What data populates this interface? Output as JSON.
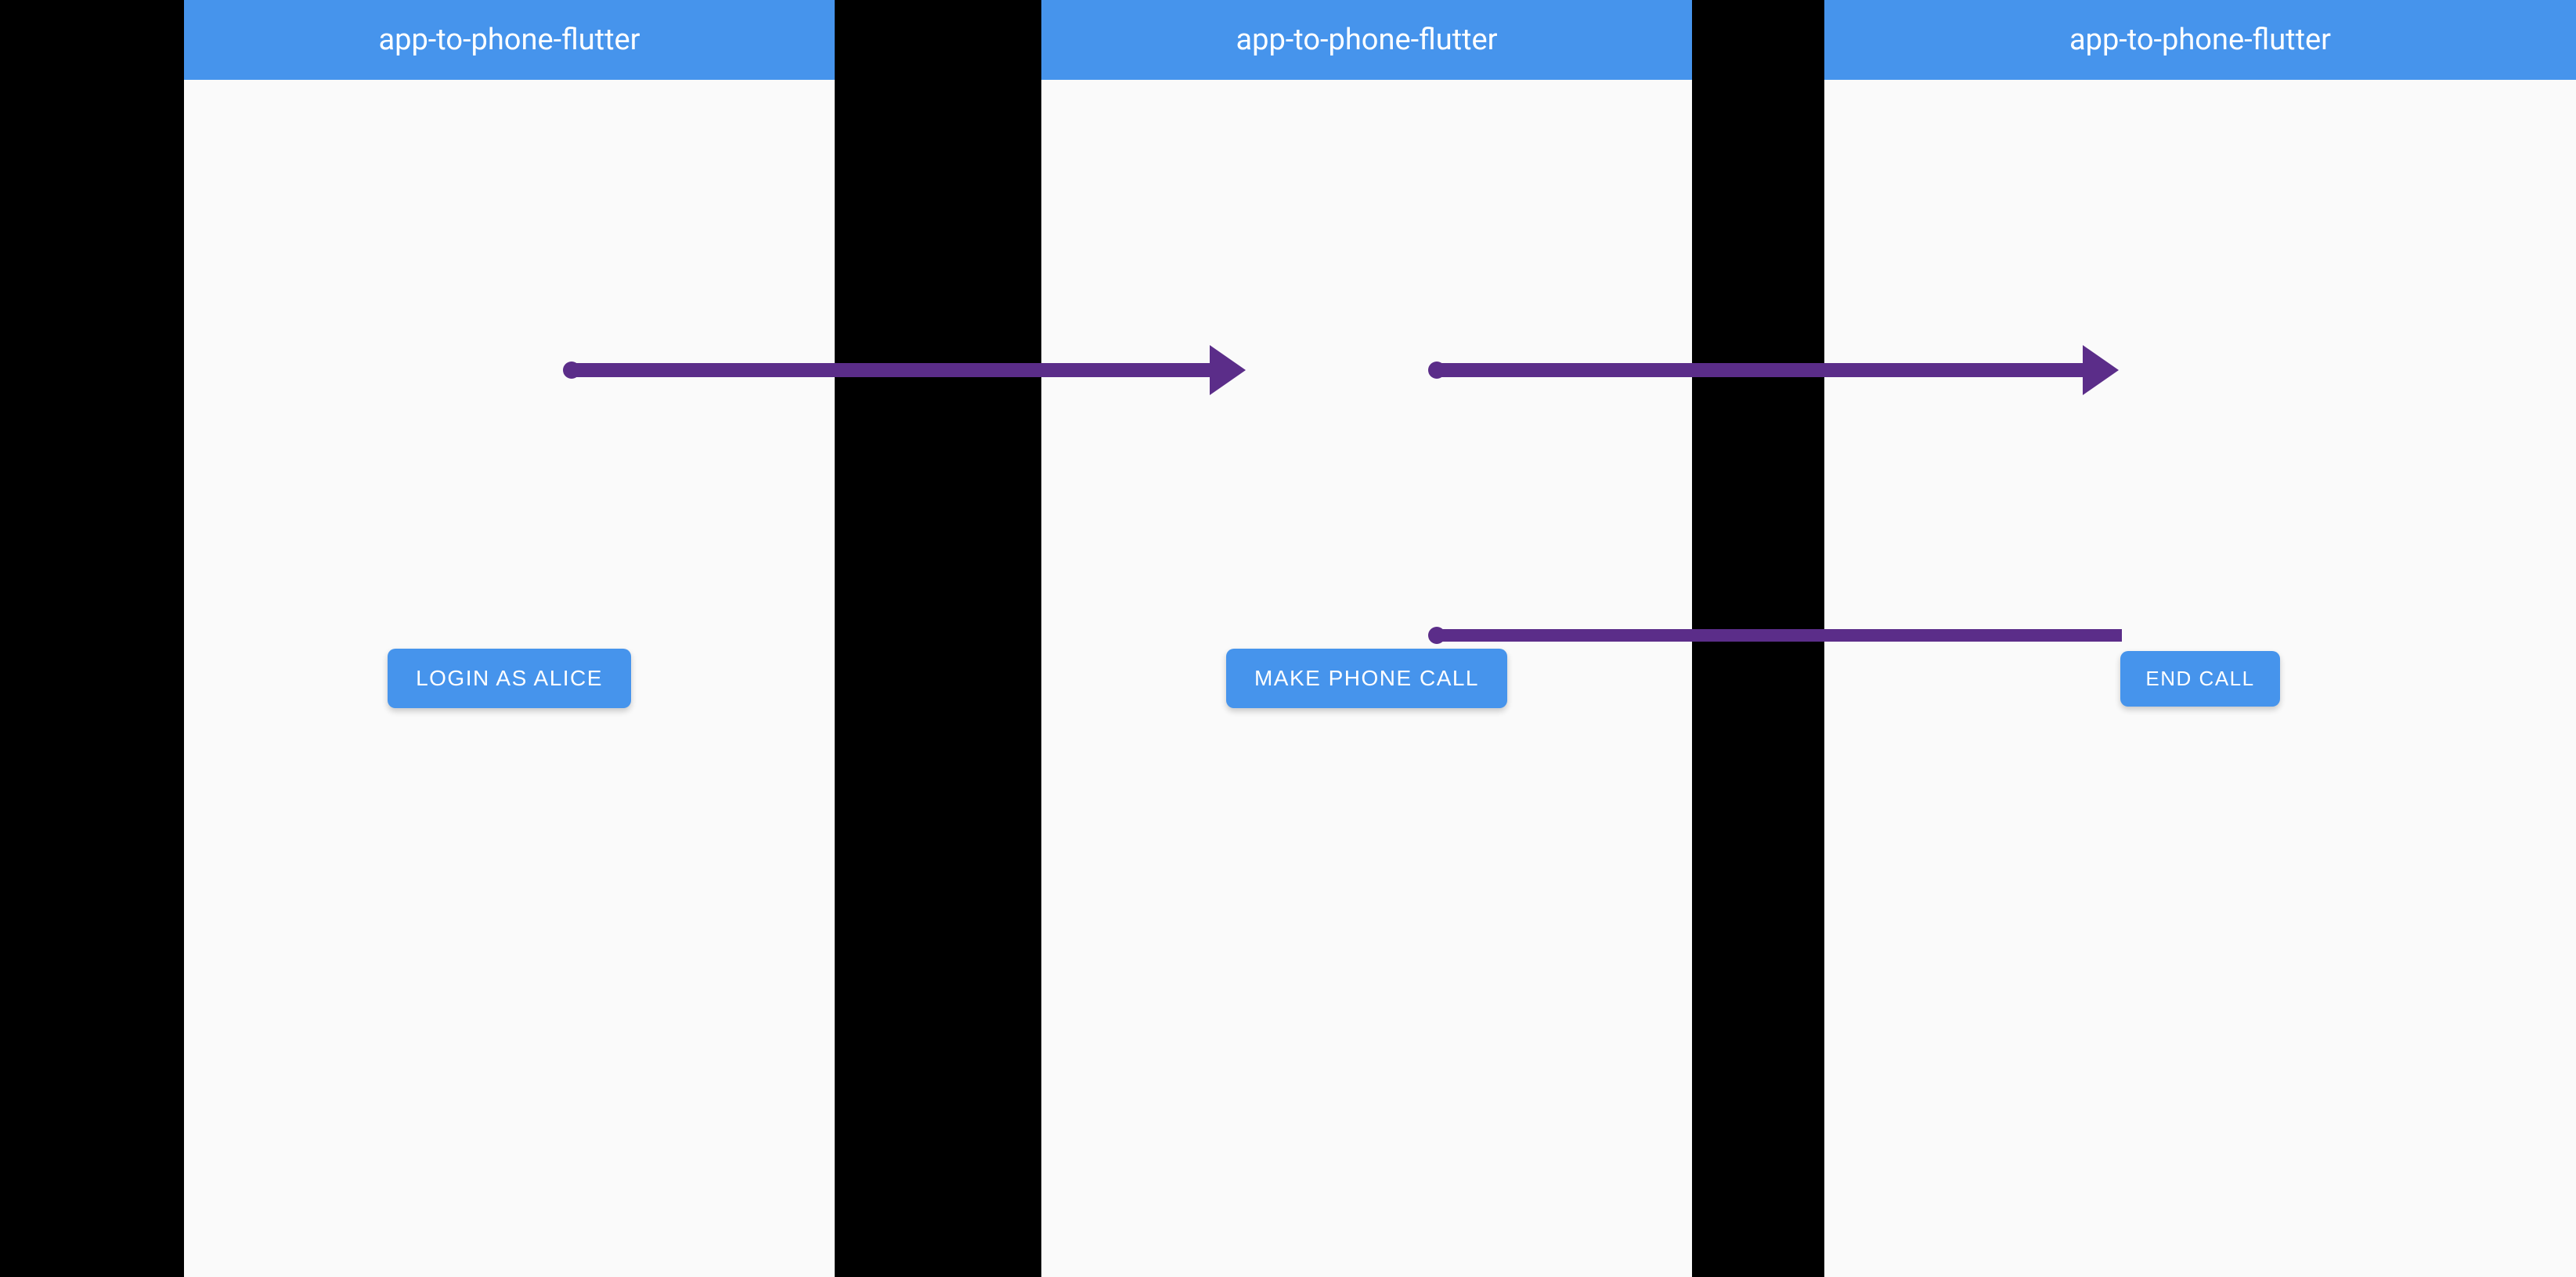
{
  "colors": {
    "app_bar": "#4694ec",
    "button": "#4694ec",
    "screen_bg": "#fafafa",
    "canvas_bg": "#000000",
    "arrow": "#5b2d89"
  },
  "screens": [
    {
      "title": "app-to-phone-flutter",
      "button_label": "LOGIN AS ALICE"
    },
    {
      "title": "app-to-phone-flutter",
      "button_label": "MAKE PHONE CALL"
    },
    {
      "title": "app-to-phone-flutter",
      "button_label": "END CALL"
    }
  ]
}
